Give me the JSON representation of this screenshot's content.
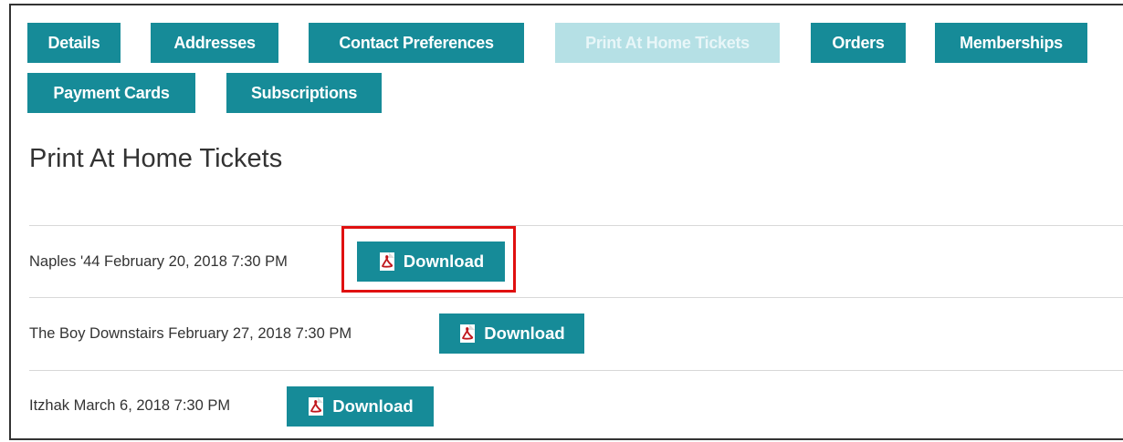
{
  "tabs": [
    {
      "label": "Details",
      "active": false
    },
    {
      "label": "Addresses",
      "active": false
    },
    {
      "label": "Contact Preferences",
      "active": false
    },
    {
      "label": "Print At Home Tickets",
      "active": true
    },
    {
      "label": "Orders",
      "active": false
    },
    {
      "label": "Memberships",
      "active": false
    },
    {
      "label": "Payment Cards",
      "active": false
    },
    {
      "label": "Subscriptions",
      "active": false
    }
  ],
  "page_title": "Print At Home Tickets",
  "tickets": [
    {
      "text": "Naples '44 February 20, 2018 7:30 PM",
      "download_label": "Download",
      "icon": "pdf-icon"
    },
    {
      "text": "The Boy Downstairs February 27, 2018 7:30 PM",
      "download_label": "Download",
      "icon": "pdf-icon"
    },
    {
      "text": "Itzhak March 6, 2018 7:30 PM",
      "download_label": "Download",
      "icon": "pdf-icon"
    }
  ],
  "colors": {
    "accent": "#168b98",
    "active_tab": "#b5e0e5",
    "highlight": "#e01010"
  }
}
